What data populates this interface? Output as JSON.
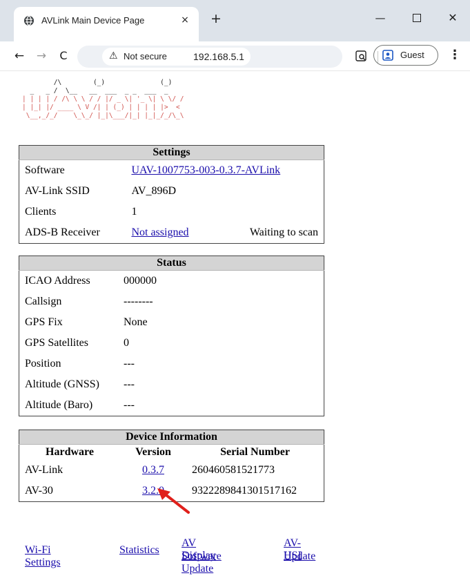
{
  "browser": {
    "tab_title": "AVLink Main Device Page",
    "tab_close": "×",
    "new_tab": "+",
    "security_label": "Not secure",
    "url": "192.168.5.1",
    "profile_label": "Guest"
  },
  "logo": {
    "ascii_lines": [
      "        /\\        (_)              (_)",
      "  _   _ /  \\__   __  ___  _ _  ___  _",
      "| | | | / /\\ \\ \\ / / |/ _ \\| '_ \\| \\ \\/ /",
      "| |_| |/ ____ \\ V /| | (_) | | | | |>  <",
      " \\__,_/_/    \\_\\_/ |_|\\___/|_| |_|_/_/\\_\\"
    ]
  },
  "settings": {
    "caption": "Settings",
    "rows": [
      {
        "label": "Software",
        "value": "UAV-1007753-003-0.3.7-AVLink",
        "extra": ""
      },
      {
        "label": "AV-Link SSID",
        "value": "AV_896D",
        "extra": ""
      },
      {
        "label": "Clients",
        "value": "1",
        "extra": ""
      },
      {
        "label": "ADS-B Receiver",
        "value": "Not assigned",
        "extra": "Waiting to scan"
      }
    ]
  },
  "status": {
    "caption": "Status",
    "rows": [
      {
        "label": "ICAO Address",
        "value": "000000"
      },
      {
        "label": "Callsign",
        "value": "--------"
      },
      {
        "label": "GPS Fix",
        "value": "None"
      },
      {
        "label": "GPS Satellites",
        "value": "0"
      },
      {
        "label": "Position",
        "value": "---"
      },
      {
        "label": "Altitude (GNSS)",
        "value": "---"
      },
      {
        "label": "Altitude (Baro)",
        "value": "---"
      }
    ]
  },
  "device_info": {
    "caption": "Device Information",
    "headers": [
      "Hardware",
      "Version",
      "Serial Number"
    ],
    "rows": [
      {
        "hardware": "AV-Link",
        "version": "0.3.7",
        "serial": "260460581521773"
      },
      {
        "hardware": "AV-30",
        "version": "3.2.0",
        "serial": "9322289841301517162"
      }
    ]
  },
  "bottom_links": {
    "wifi": "Wi-Fi Settings",
    "statistics": "Statistics",
    "display_update_1": "AV Display",
    "display_update_2": "Software Update",
    "hsi_update_1": "AV-HSI",
    "hsi_update_2": "Update"
  },
  "colors": {
    "link": "#1a0dab",
    "ascii_logo": "#d0504b",
    "annotation_arrow": "#e0201b",
    "table_caption_bg": "#d4d4d4"
  }
}
